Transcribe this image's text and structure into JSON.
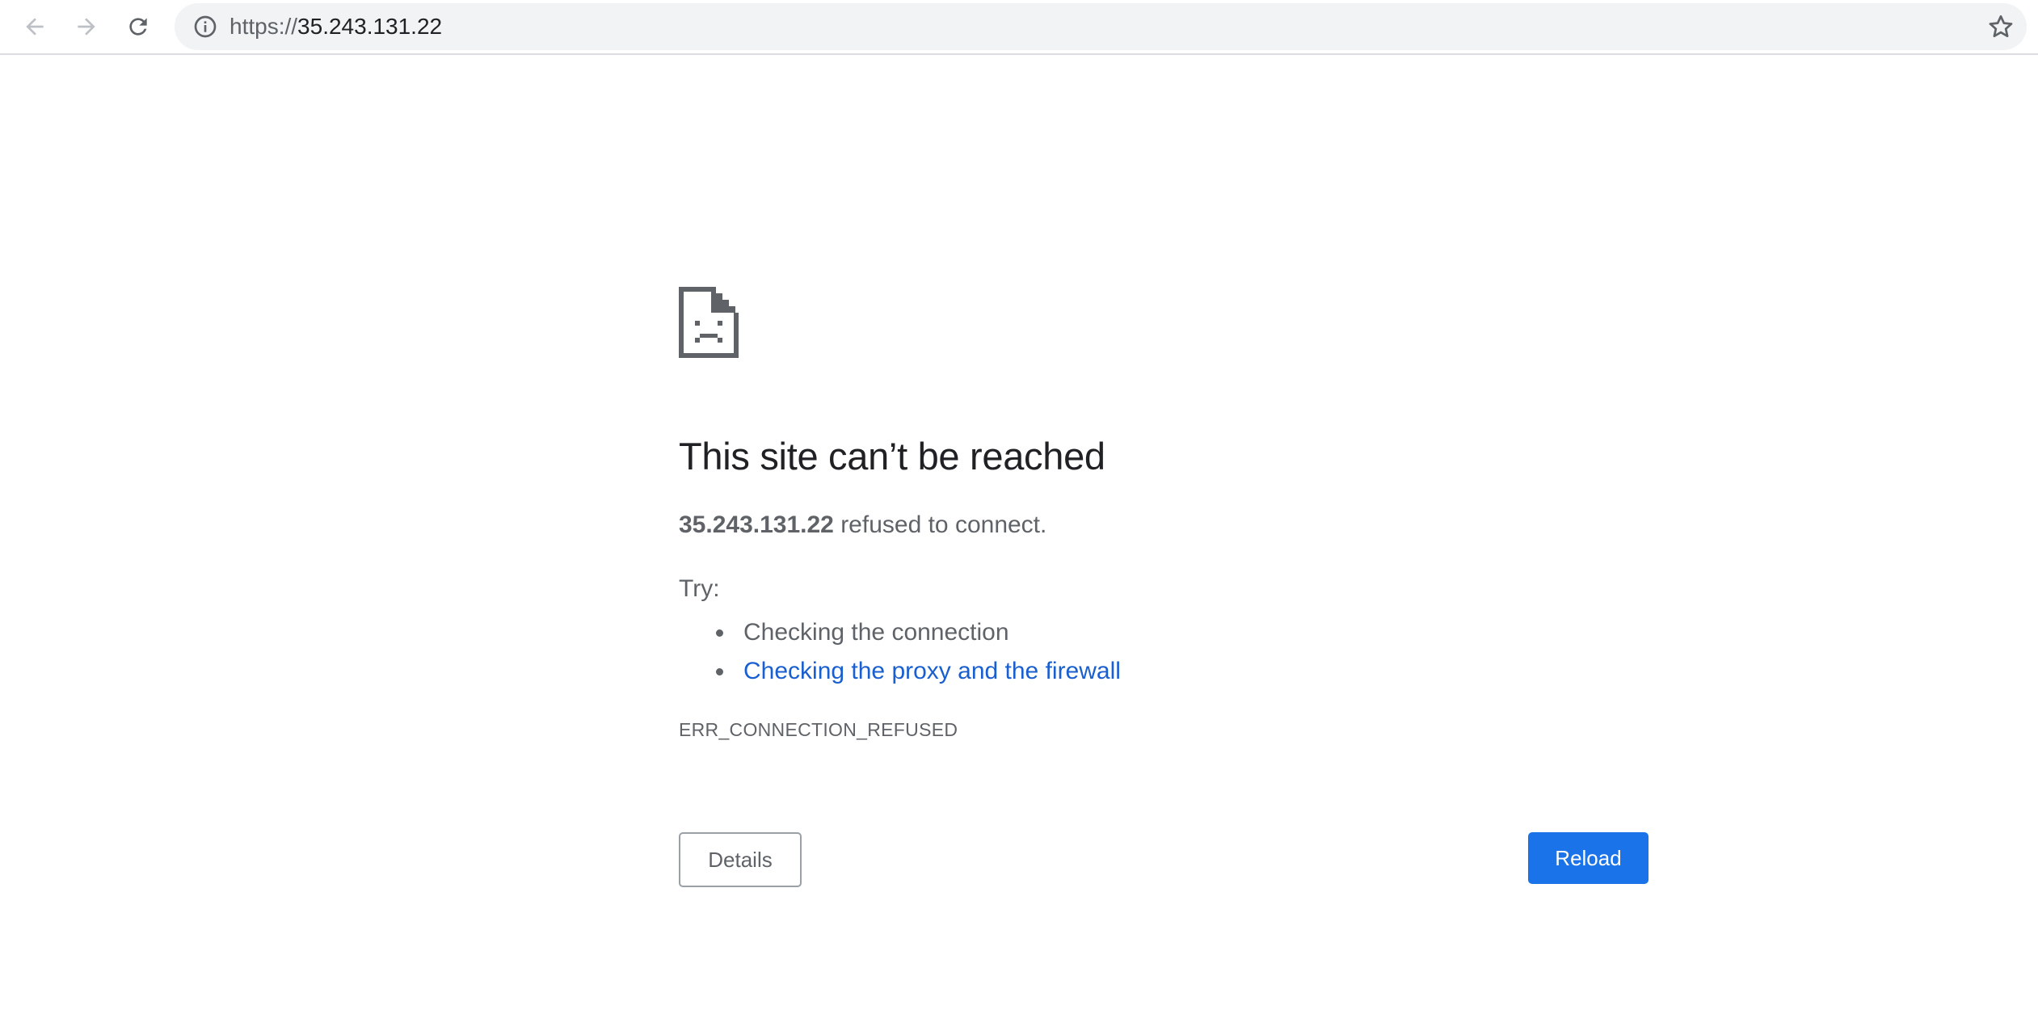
{
  "browser": {
    "url_scheme": "https://",
    "url_host": "35.243.131.22",
    "icons": {
      "back": "arrow-left-icon",
      "forward": "arrow-right-icon",
      "reload": "reload-icon",
      "site_info": "info-icon",
      "bookmark": "star-icon"
    }
  },
  "error_page": {
    "icon": "sad-page-icon",
    "heading": "This site can’t be reached",
    "host": "35.243.131.22",
    "summary_rest": " refused to connect.",
    "try_label": "Try:",
    "suggestions": [
      "Checking the connection",
      "Checking the proxy and the firewall"
    ],
    "error_code": "ERR_CONNECTION_REFUSED",
    "details_label": "Details",
    "reload_label": "Reload"
  },
  "colors": {
    "accent_blue": "#1a73e8",
    "link_blue": "#1a5fcf",
    "text_gray": "#5f6368",
    "heading_text": "#202124",
    "omnibox_bg": "#f1f3f4"
  }
}
